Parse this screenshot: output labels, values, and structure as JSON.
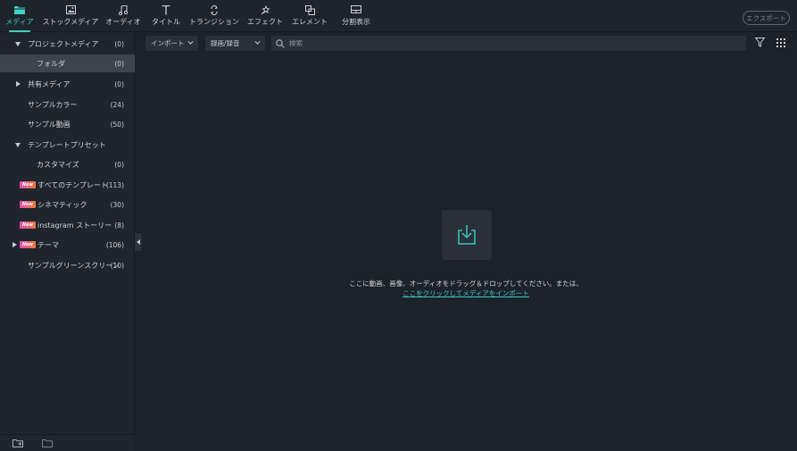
{
  "toolbar": {
    "tabs": [
      {
        "label": "メディア",
        "icon": "folder-icon"
      },
      {
        "label": "ストックメディア",
        "icon": "stock-media-icon"
      },
      {
        "label": "オーディオ",
        "icon": "music-note-icon"
      },
      {
        "label": "タイトル",
        "icon": "title-t-icon"
      },
      {
        "label": "トランジション",
        "icon": "transition-icon"
      },
      {
        "label": "エフェクト",
        "icon": "effects-icon"
      },
      {
        "label": "エレメント",
        "icon": "elements-icon"
      },
      {
        "label": "分割表示",
        "icon": "split-screen-icon"
      }
    ],
    "export_label": "エクスポート",
    "accent": "#43d1c5"
  },
  "sidebar": {
    "items": [
      {
        "label": "プロジェクトメディア",
        "count": "(0)"
      },
      {
        "label": "フォルダ",
        "count": "(0)"
      },
      {
        "label": "共有メディア",
        "count": "(0)"
      },
      {
        "label": "サンプルカラー",
        "count": "(24)"
      },
      {
        "label": "サンプル動画",
        "count": "(50)"
      },
      {
        "label": "テンプレートプリセット",
        "count": ""
      },
      {
        "label": "カスタマイズ",
        "count": "(0)"
      },
      {
        "label": "すべてのテンプレート",
        "count": "(113)",
        "badge": "New"
      },
      {
        "label": "シネマティック",
        "count": "(30)",
        "badge": "New"
      },
      {
        "label": "instagram ストーリー",
        "count": "(8)",
        "badge": "New"
      },
      {
        "label": "テーマ",
        "count": "(106)",
        "badge": "New"
      },
      {
        "label": "サンプルグリーンスクリーン",
        "count": "(10)"
      }
    ]
  },
  "filterbar": {
    "import_label": "インポート",
    "record_label": "録画/録音",
    "search_placeholder": "検索"
  },
  "main": {
    "drop_text": "ここに動画、画像、オーディオをドラッグ＆ドロップしてください。または、",
    "drop_link": "ここをクリックしてメディアをインポート"
  }
}
